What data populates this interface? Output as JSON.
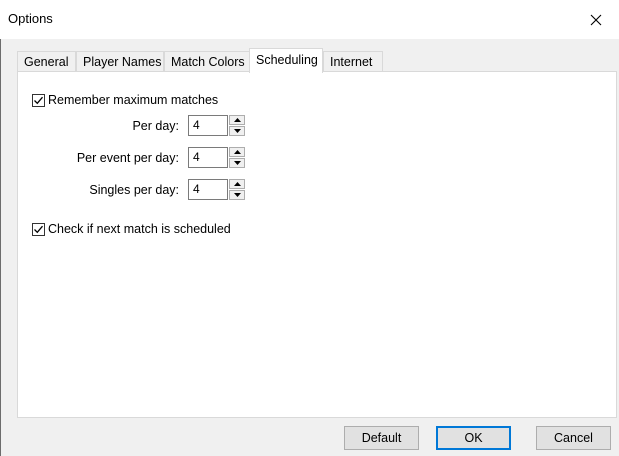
{
  "window": {
    "title": "Options"
  },
  "tabs": [
    {
      "label": "General"
    },
    {
      "label": "Player Names"
    },
    {
      "label": "Match Colors"
    },
    {
      "label": "Scheduling"
    },
    {
      "label": "Internet"
    }
  ],
  "active_tab": "Scheduling",
  "scheduling": {
    "remember_max": {
      "label": "Remember maximum matches",
      "checked": true
    },
    "rows": [
      {
        "label": "Per day:",
        "value": "4"
      },
      {
        "label": "Per event per day:",
        "value": "4"
      },
      {
        "label": "Singles per day:",
        "value": "4"
      }
    ],
    "check_next": {
      "label": "Check if next match is scheduled",
      "checked": true
    }
  },
  "buttons": {
    "default": "Default",
    "ok": "OK",
    "cancel": "Cancel"
  },
  "colors": {
    "focus_accent": "#0078d7",
    "panel_border": "#d9d9d9",
    "dialog_bg": "#f0f0f0"
  }
}
